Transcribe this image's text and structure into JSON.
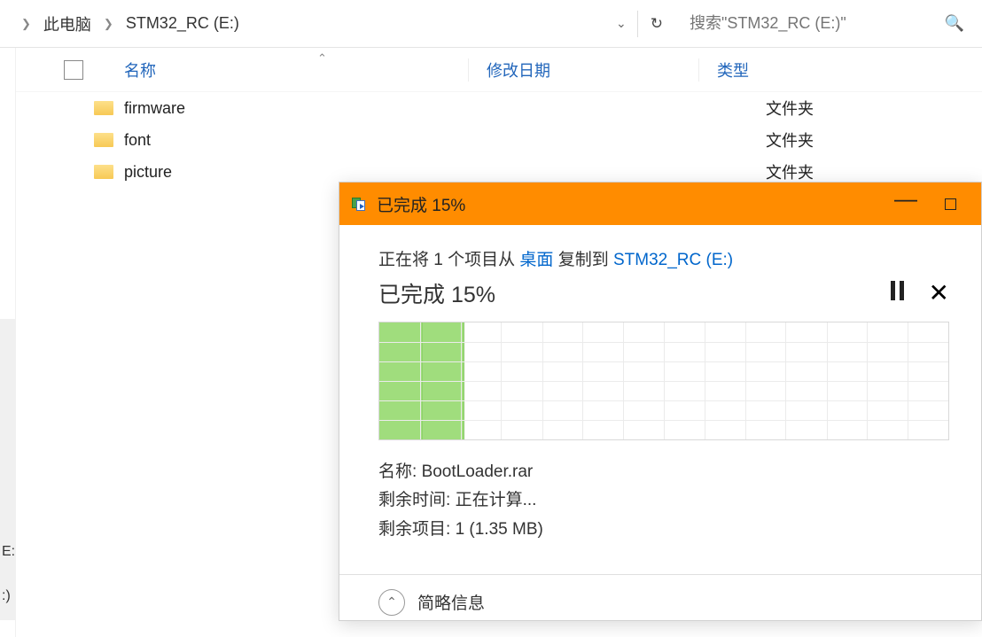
{
  "breadcrumb": {
    "items": [
      "此电脑",
      "STM32_RC (E:)"
    ]
  },
  "search": {
    "placeholder": "搜索\"STM32_RC (E:)\""
  },
  "columns": {
    "name": "名称",
    "date": "修改日期",
    "type": "类型"
  },
  "files": [
    {
      "name": "firmware",
      "date": "",
      "type": "文件夹"
    },
    {
      "name": "font",
      "date": "",
      "type": "文件夹"
    },
    {
      "name": "picture",
      "date": "",
      "type": "文件夹"
    }
  ],
  "sidebar_stubs": [
    "E:",
    ":)"
  ],
  "dialog": {
    "title": "已完成 15%",
    "desc_prefix": "正在将 1 个项目从 ",
    "desc_src": "桌面",
    "desc_mid": " 复制到 ",
    "desc_dst": "STM32_RC (E:)",
    "progress_text": "已完成 15%",
    "lines": {
      "name_label": "名称:",
      "name_value": "BootLoader.rar",
      "time_label": "剩余时间:",
      "time_value": "正在计算...",
      "items_label": "剩余项目:",
      "items_value": "1 (1.35 MB)"
    },
    "footer": "简略信息"
  },
  "chart_data": {
    "type": "area",
    "title": "Copy throughput",
    "xlabel": "",
    "ylabel": "",
    "progress_percent": 15,
    "categories": [
      0,
      1,
      2,
      3,
      4,
      5,
      6,
      7,
      8,
      9,
      10,
      11,
      12,
      13
    ],
    "values": [
      100,
      100,
      0,
      0,
      0,
      0,
      0,
      0,
      0,
      0,
      0,
      0,
      0,
      0
    ],
    "xlim": [
      0,
      14
    ],
    "ylim": [
      0,
      100
    ]
  }
}
